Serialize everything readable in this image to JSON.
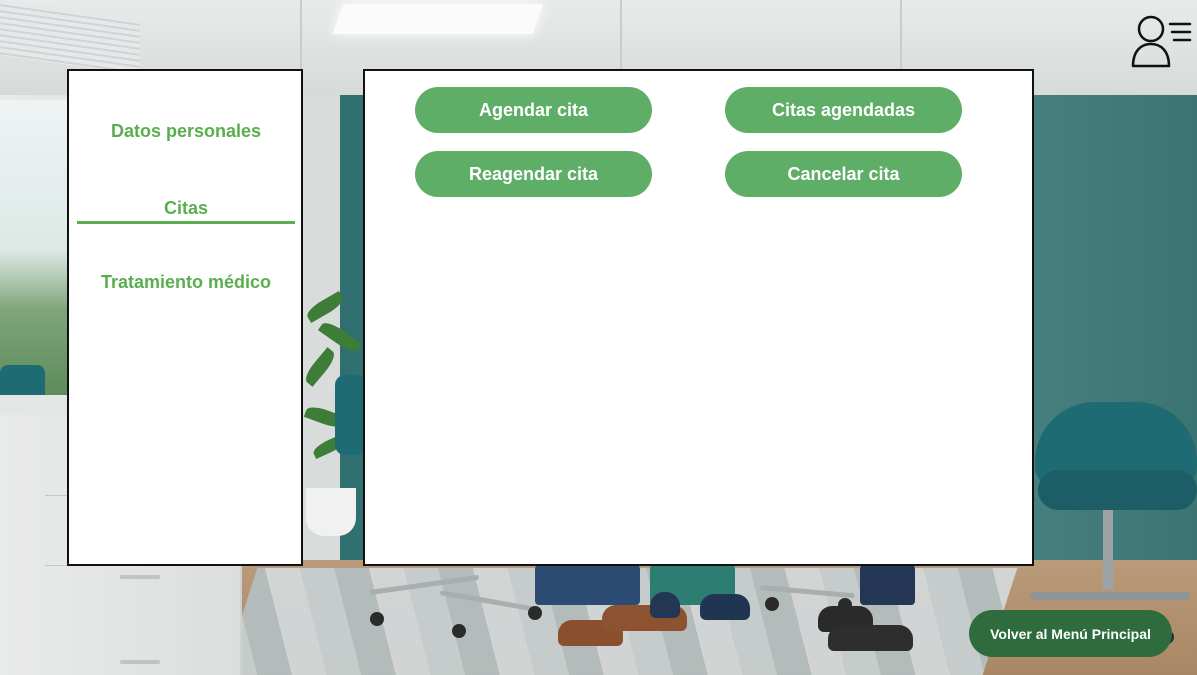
{
  "sidebar": {
    "items": [
      {
        "label": "Datos personales",
        "active": false
      },
      {
        "label": "Citas",
        "active": true
      },
      {
        "label": "Tratamiento médico",
        "active": false
      }
    ]
  },
  "main": {
    "buttons": {
      "agendar": "Agendar cita",
      "agendadas": "Citas agendadas",
      "reagendar": "Reagendar cita",
      "cancelar": "Cancelar cita"
    }
  },
  "footer": {
    "back_label": "Volver al Menú Principal"
  },
  "header": {
    "user_menu_icon": "user-menu-icon"
  },
  "colors": {
    "accent_green": "#5aae4f",
    "button_green": "#5fae68",
    "back_button_green": "#2e6c3e"
  }
}
